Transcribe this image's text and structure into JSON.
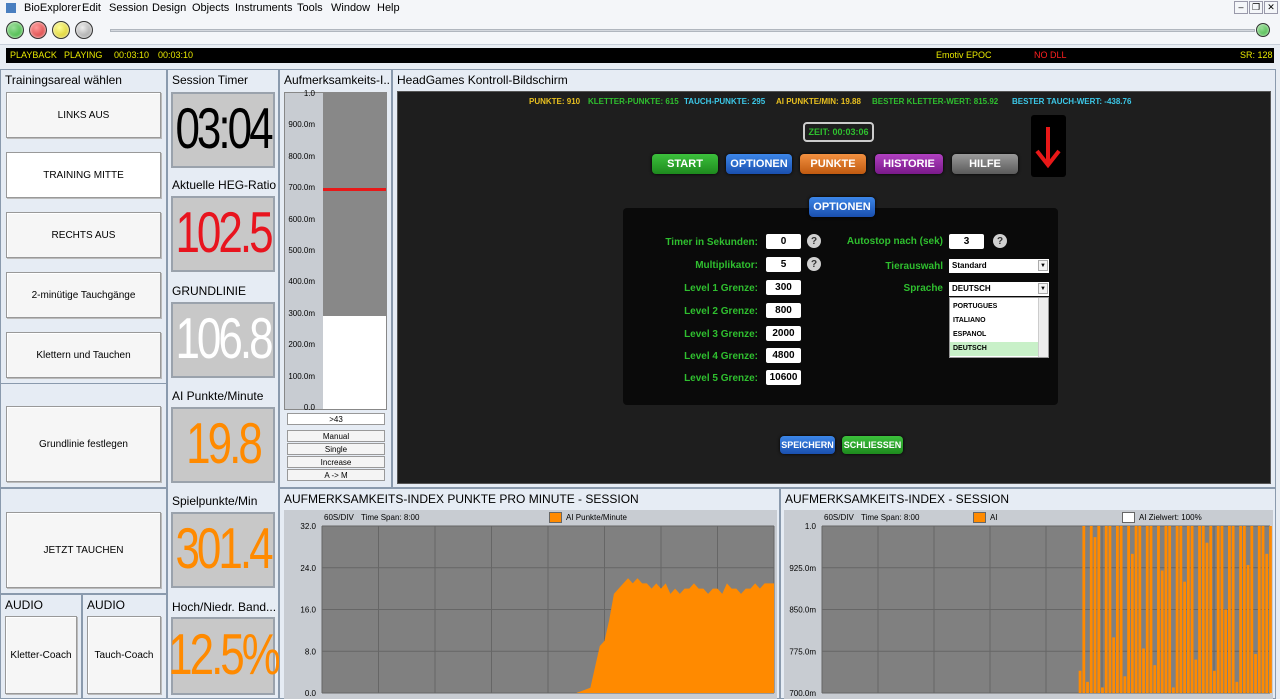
{
  "menu": [
    "BioExplorer",
    "Edit",
    "Session",
    "Design",
    "Objects",
    "Instruments",
    "Tools",
    "Window",
    "Help"
  ],
  "status": {
    "mode": "PLAYBACK",
    "state": "PLAYING",
    "time1": "00:03:10",
    "time2": "00:03:10",
    "device": "Emotiv EPOC",
    "dll": "NO DLL",
    "sr": "SR: 128"
  },
  "left": {
    "title": "Trainingsareal wählen",
    "buttons": [
      "LINKS AUS",
      "TRAINING MITTE",
      "RECHTS AUS",
      "2-minütige Tauchgänge",
      "Klettern und Tauchen"
    ],
    "baseline_button": "Grundlinie festlegen",
    "dive_button": "JETZT TAUCHEN",
    "audio1_title": "AUDIO",
    "audio2_title": "AUDIO",
    "coach1": "Kletter-Coach",
    "coach2": "Tauch-Coach"
  },
  "meters": {
    "timer_title": "Session Timer",
    "timer_value": "03:04",
    "heg_title": "Aktuelle HEG-Ratio",
    "heg_value": "102.5",
    "baseline_title": "GRUNDLINIE",
    "baseline_value": "106.8",
    "ai_title": "AI Punkte/Minute",
    "ai_value": "19.8",
    "game_title": "Spielpunkte/Min",
    "game_value": "301.4",
    "band_title": "Hoch/Niedr. Band...",
    "band_value": "12.5%"
  },
  "attention": {
    "title": "Aufmerksamkeits-I...",
    "ticks": [
      "1.0",
      "900.0m",
      "800.0m",
      "700.0m",
      "600.0m",
      "500.0m",
      "400.0m",
      "300.0m",
      "200.0m",
      "100.0m",
      "0.0"
    ],
    "threshold": 0.7,
    "level": 0.295,
    "readout": ">43",
    "mode_buttons": [
      "Manual",
      "Single",
      "Increase",
      "A -> M"
    ]
  },
  "headgames": {
    "title": "HeadGames Kontroll-Bildschirm",
    "stats": [
      {
        "label": "PUNKTE: 910",
        "color": "#e8c020"
      },
      {
        "label": "KLETTER-PUNKTE: 615",
        "color": "#2fbf2f"
      },
      {
        "label": "TAUCH-PUNKTE: 295",
        "color": "#3cc8e8"
      },
      {
        "label": "AI PUNKTE/MIN: 19.88",
        "color": "#e8c020"
      },
      {
        "label": "BESTER KLETTER-WERT: 815.92",
        "color": "#2fbf2f"
      },
      {
        "label": "BESTER TAUCH-WERT: -438.76",
        "color": "#3cc8e8"
      }
    ],
    "time": "ZEIT: 00:03:06",
    "nav": [
      "START",
      "OPTIONEN",
      "PUNKTE",
      "HISTORIE",
      "HILFE"
    ],
    "options_title": "OPTIONEN",
    "fields": [
      {
        "label": "Timer in Sekunden:",
        "value": "0"
      },
      {
        "label": "Multiplikator:",
        "value": "5"
      },
      {
        "label": "Level 1 Grenze:",
        "value": "300"
      },
      {
        "label": "Level 2 Grenze:",
        "value": "800"
      },
      {
        "label": "Level 3 Grenze:",
        "value": "2000"
      },
      {
        "label": "Level 4 Grenze:",
        "value": "4800"
      },
      {
        "label": "Level 5 Grenze:",
        "value": "10600"
      }
    ],
    "autostop_label": "Autostop nach (sek)",
    "autostop_value": "3",
    "tier_label": "Tierauswahl",
    "tier_value": "Standard",
    "lang_label": "Sprache",
    "lang_value": "DEUTSCH",
    "lang_options": [
      "PORTUGUES",
      "ITALIANO",
      "ESPANOL",
      "DEUTSCH"
    ],
    "help_mark": "?",
    "save": "SPEICHERN",
    "close": "SCHLIESSEN"
  },
  "chart1": {
    "title": "AUFMERKSAMKEITS-INDEX PUNKTE PRO MINUTE - SESSION",
    "div": "60S/DIV",
    "span": "Time Span: 8:00",
    "legend": "AI Punkte/Minute"
  },
  "chart2": {
    "title": "AUFMERKSAMKEITS-INDEX - SESSION",
    "div": "60S/DIV",
    "span": "Time Span: 8:00",
    "legend1": "AI",
    "legend2": "AI Zielwert: 100%"
  },
  "chart_data": [
    {
      "type": "area",
      "title": "AUFMERKSAMKEITS-INDEX PUNKTE PRO MINUTE - SESSION",
      "yticks": [
        "32.0",
        "24.0",
        "16.0",
        "8.0",
        "0.0"
      ],
      "ylim": [
        0,
        32
      ],
      "xlim": [
        0,
        480
      ],
      "series": [
        {
          "name": "AI Punkte/Minute",
          "color": "#ff8a00",
          "x": [
            0,
            270,
            285,
            290,
            295,
            300,
            305,
            310,
            315,
            320,
            325,
            330,
            335,
            340,
            345,
            350,
            355,
            360,
            365,
            370,
            375,
            380,
            385,
            390,
            395,
            400,
            405,
            410,
            415,
            420,
            425,
            430,
            435,
            440,
            445,
            450,
            455,
            460,
            465,
            470,
            475,
            480
          ],
          "y": [
            0,
            0,
            1,
            5,
            9,
            10,
            14,
            19,
            20,
            21,
            22,
            21,
            22,
            21,
            21,
            20,
            21,
            20,
            21,
            19,
            20,
            19,
            20,
            20,
            21,
            20,
            20,
            19,
            20,
            20,
            19,
            21,
            20,
            20,
            19,
            20,
            20,
            21,
            20,
            21,
            21,
            21
          ]
        }
      ]
    },
    {
      "type": "bar",
      "title": "AUFMERKSAMKEITS-INDEX - SESSION",
      "yticks": [
        "1.0",
        "925.0m",
        "850.0m",
        "775.0m",
        "700.0m"
      ],
      "ylim": [
        0.7,
        1.0
      ],
      "xlim": [
        0,
        480
      ],
      "series": [
        {
          "name": "AI",
          "color": "#ff8a00",
          "x": [
            275,
            279,
            283,
            287,
            291,
            295,
            299,
            303,
            307,
            311,
            315,
            319,
            323,
            327,
            331,
            335,
            339,
            343,
            347,
            351,
            355,
            359,
            363,
            367,
            371,
            375,
            379,
            383,
            387,
            391,
            395,
            399,
            403,
            407,
            411,
            415,
            419,
            423,
            427,
            431,
            435,
            439,
            443,
            447,
            451,
            455,
            459,
            463,
            467,
            471,
            475,
            479
          ],
          "y": [
            0.74,
            1.0,
            0.72,
            1.0,
            0.98,
            1.0,
            0.71,
            1.0,
            1.0,
            0.8,
            1.0,
            1.0,
            0.73,
            1.0,
            0.95,
            1.0,
            1.0,
            0.78,
            1.0,
            1.0,
            0.75,
            1.0,
            0.92,
            1.0,
            1.0,
            0.71,
            1.0,
            1.0,
            0.9,
            1.0,
            1.0,
            0.76,
            1.0,
            1.0,
            0.97,
            1.0,
            0.74,
            1.0,
            1.0,
            0.85,
            1.0,
            1.0,
            0.72,
            1.0,
            1.0,
            0.93,
            1.0,
            0.77,
            1.0,
            1.0,
            0.95,
            1.0
          ]
        }
      ]
    }
  ],
  "colors": {
    "lcd_red": "#e8141e",
    "lcd_orange": "#ff8a00",
    "lcd_black": "#000000"
  }
}
